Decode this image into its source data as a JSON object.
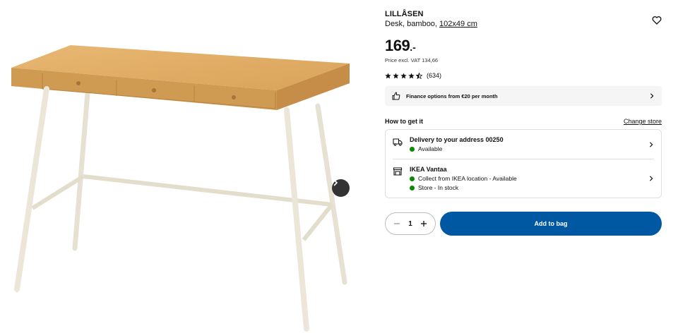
{
  "product": {
    "name": "LILLÅSEN",
    "description": "Desk, bamboo,",
    "measurement": "102x49 cm",
    "price_integer": "169",
    "price_decimal": ".-",
    "vat_note": "Price excl. VAT 134,66",
    "rating_value": 4.5,
    "rating_max": 5,
    "rating_count": "(634)"
  },
  "finance": {
    "label": "Finance options from €20 per month"
  },
  "delivery": {
    "title": "How to get it",
    "change_store": "Change store",
    "options": [
      {
        "heading": "Delivery to your address 00250",
        "lines": [
          "Available"
        ]
      },
      {
        "heading": "IKEA Vantaa",
        "lines": [
          "Collect from IKEA location - Available",
          "Store - In stock"
        ]
      }
    ]
  },
  "cart": {
    "quantity": "1",
    "add_label": "Add to bag"
  },
  "colors": {
    "brand_blue": "#0058a3",
    "available_green": "#0a8a00",
    "finance_bg": "#f5f5f5"
  }
}
